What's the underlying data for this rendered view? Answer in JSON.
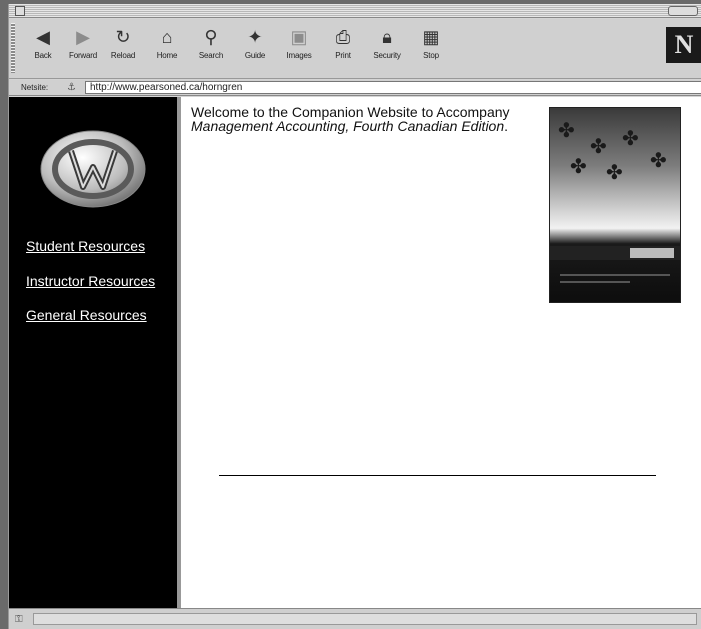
{
  "toolbar": {
    "buttons": [
      {
        "label": "Back",
        "icon": "back-icon"
      },
      {
        "label": "Forward",
        "icon": "forward-icon"
      },
      {
        "label": "Reload",
        "icon": "reload-icon"
      },
      {
        "label": "Home",
        "icon": "home-icon"
      },
      {
        "label": "Search",
        "icon": "search-icon"
      },
      {
        "label": "Guide",
        "icon": "guide-icon"
      },
      {
        "label": "Images",
        "icon": "images-icon"
      },
      {
        "label": "Print",
        "icon": "print-icon"
      },
      {
        "label": "Security",
        "icon": "security-icon"
      },
      {
        "label": "Stop",
        "icon": "stop-icon"
      }
    ],
    "brand_logo": "N"
  },
  "location": {
    "label": "Netsite:",
    "url": "http://www.pearsoned.ca/horngren"
  },
  "sidebar": {
    "links": [
      {
        "label": "Student Resources"
      },
      {
        "label": "Instructor Resources"
      },
      {
        "label": "General Resources"
      }
    ]
  },
  "main": {
    "welcome_prefix": "Welcome to the Companion Website to Accompany ",
    "book_title": "Management Accounting, Fourth Canadian Edition",
    "welcome_suffix": "."
  },
  "colors": {
    "sidebar_bg": "#000000",
    "content_bg": "#ffffff",
    "link_text": "#ffffff"
  }
}
